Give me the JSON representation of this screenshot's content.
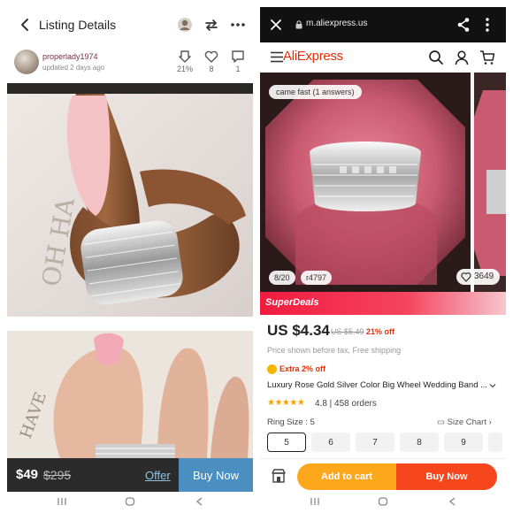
{
  "left": {
    "header": {
      "title": "Listing Details"
    },
    "seller": {
      "username": "properlady1974",
      "updated": "updated 2 days ago"
    },
    "stats": {
      "price_drop": "21%",
      "likes": "8",
      "comments": "1"
    },
    "bottom": {
      "price": "$49",
      "original_price": "$295",
      "offer_label": "Offer",
      "buy_label": "Buy Now"
    }
  },
  "right": {
    "browser": {
      "url": "m.aliexpress.us"
    },
    "app": {
      "logo": "AliExpress"
    },
    "gallery": {
      "review_chip": "came fast (1 answers)",
      "image_counter": "8/20",
      "views": "r4797",
      "favorites": "3649"
    },
    "superdeals_label": "SuperDeals",
    "price": {
      "current": "US $4.34",
      "original": "US $5.49",
      "discount": "21% off"
    },
    "price_note": "Price shown before tax, Free shipping",
    "extra_discount": "Extra 2% off",
    "product_title": "Luxury Rose Gold Silver Color Big Wheel Wedding Band ...",
    "rating": {
      "stars": "★★★★★",
      "text": "4.8 | 458 orders"
    },
    "size": {
      "label": "Ring Size : 5",
      "chart_label": "Size Chart",
      "options": [
        "5",
        "6",
        "7",
        "8",
        "9"
      ],
      "selected": "5"
    },
    "bottom": {
      "add_to_cart": "Add to cart",
      "buy_now": "Buy Now"
    }
  },
  "colors": {
    "aliexpress_red": "#e62e04",
    "cart_orange": "#fda81b",
    "buy_orange": "#f5461d",
    "poshmark_blue": "#4a8fc0",
    "superdeals_red": "#f21b3f"
  }
}
